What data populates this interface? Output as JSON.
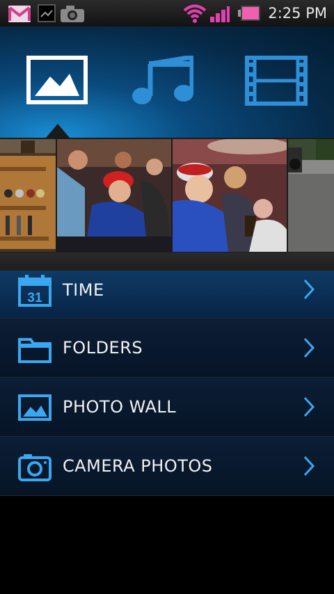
{
  "status_bar": {
    "time": "2:25 PM",
    "icons": [
      "gmail-icon",
      "notification-icon",
      "camera-icon",
      "wifi-icon",
      "signal-icon",
      "battery-icon"
    ]
  },
  "category_tabs": [
    {
      "name": "photos-tab",
      "icon": "image-icon",
      "selected": true
    },
    {
      "name": "music-tab",
      "icon": "music-note-icon",
      "selected": false
    },
    {
      "name": "videos-tab",
      "icon": "film-icon",
      "selected": false
    }
  ],
  "thumbnails": [
    "bottle-rack-photo",
    "crowd-photo-1",
    "crowd-photo-2",
    "outdoor-photo"
  ],
  "menu": {
    "items": [
      {
        "label": "TIME",
        "icon": "calendar-icon",
        "calendar_number": "31"
      },
      {
        "label": "FOLDERS",
        "icon": "folder-icon"
      },
      {
        "label": "PHOTO WALL",
        "icon": "photo-icon"
      },
      {
        "label": "CAMERA PHOTOS",
        "icon": "camera-icon"
      }
    ]
  },
  "colors": {
    "accent": "#2f9fe6",
    "header_dark": "#041b30"
  }
}
